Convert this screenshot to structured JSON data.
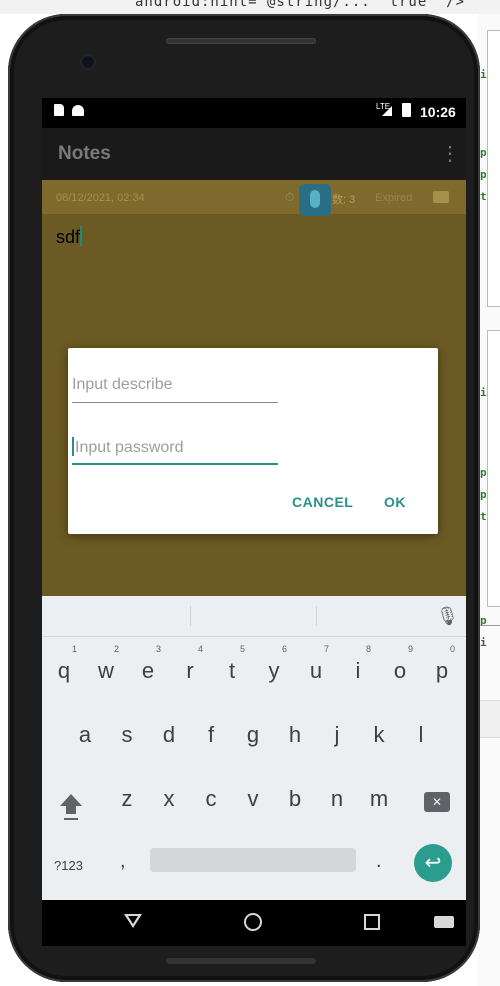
{
  "ide": {
    "code_line": "android:hint=\"@string/...\" true\" />",
    "letters": [
      "i",
      "p",
      "p",
      "t",
      "i",
      "p",
      "p",
      "t",
      "p",
      "i"
    ]
  },
  "status_bar": {
    "lte": "LTE",
    "time": "10:26"
  },
  "app_bar": {
    "title": "Notes",
    "overflow_icon": "⋮"
  },
  "note": {
    "date": "08/12/2021, 02:34",
    "count": "数: 3",
    "expired": "Expired",
    "body": "sdf"
  },
  "dialog": {
    "describe_placeholder": "Input describe",
    "password_placeholder": "Input password",
    "cancel_label": "CANCEL",
    "ok_label": "OK"
  },
  "keyboard": {
    "row1": [
      "q",
      "w",
      "e",
      "r",
      "t",
      "y",
      "u",
      "i",
      "o",
      "p"
    ],
    "row1_hints": [
      "1",
      "2",
      "3",
      "4",
      "5",
      "6",
      "7",
      "8",
      "9",
      "0"
    ],
    "row2": [
      "a",
      "s",
      "d",
      "f",
      "g",
      "h",
      "j",
      "k",
      "l"
    ],
    "row3": [
      "z",
      "x",
      "c",
      "v",
      "b",
      "n",
      "m"
    ],
    "symbols_label": "?123",
    "comma": ",",
    "period": ".",
    "enter_icon": "↩"
  },
  "colors": {
    "accent": "#2a8f86",
    "note_bg": "#6b5a23",
    "keyboard_bg": "#eceff1"
  }
}
